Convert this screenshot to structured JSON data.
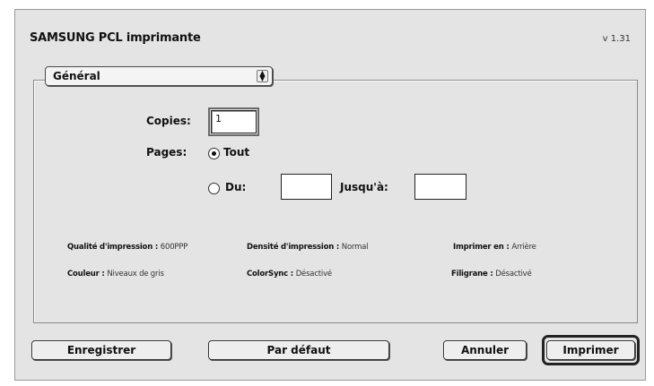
{
  "dialog": {
    "title": "SAMSUNG PCL imprimante",
    "version": "v 1.31"
  },
  "panel_popup": {
    "selected": "Général",
    "icon": "up-down-arrows-icon"
  },
  "copies": {
    "label": "Copies:",
    "value": "1"
  },
  "pages": {
    "label": "Pages:",
    "all_label": "Tout",
    "from_label": "Du:",
    "to_label": "Jusqu'à:",
    "from_value": "",
    "to_value": "",
    "selected": "Tout"
  },
  "info": {
    "quality_label": "Qualité d'impression",
    "quality_value": "600PPP",
    "density_label": "Densité d'impression",
    "density_value": "Normal",
    "printon_label": "Imprimer en",
    "printon_value": "Arrière",
    "color_label": "Couleur",
    "color_value": "Niveaux de gris",
    "colorsync_label": "ColorSync",
    "colorsync_value": "Désactivé",
    "watermark_label": "Filigrane",
    "watermark_value": "Désactivé"
  },
  "buttons": {
    "save": "Enregistrer",
    "default": "Par défaut",
    "cancel": "Annuler",
    "print": "Imprimer"
  }
}
